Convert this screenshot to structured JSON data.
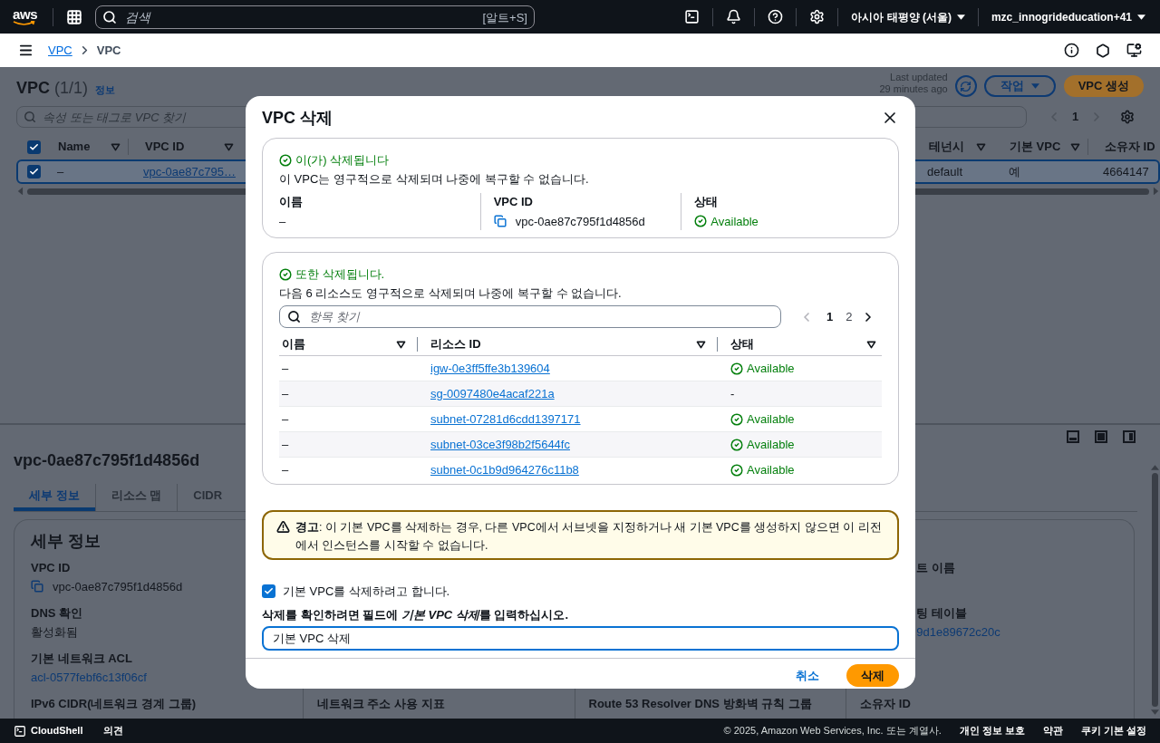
{
  "top_nav": {
    "logo": "aws",
    "search_placeholder": "검색",
    "shortcut": "[알트+S]",
    "region": "아시아 태평양 (서울)",
    "account": "mzc_innogrideducation+41"
  },
  "breadcrumbs": [
    {
      "label": "VPC",
      "link": true
    },
    {
      "label": "VPC",
      "link": false
    }
  ],
  "header": {
    "title": "VPC",
    "count": "(1/1)",
    "info": "정보",
    "last_updated": "Last updated",
    "updated_ago": "29 minutes ago",
    "actions_button": "작업",
    "create_button": "VPC 생성"
  },
  "filter": {
    "placeholder": "속성 또는 태그로 VPC 찾기",
    "page": "1"
  },
  "table": {
    "all_selected": true,
    "columns": [
      "Name",
      "VPC ID",
      "테넌시",
      "기본 VPC",
      "소유자 ID"
    ],
    "rows": [
      {
        "selected": true,
        "cells": [
          {
            "text": "–",
            "link": false
          },
          {
            "text": "vpc-0ae87c795…",
            "link": true
          },
          {
            "text": "default",
            "link": false
          },
          {
            "text": "예",
            "link": false
          },
          {
            "text": "4664147",
            "link": false
          }
        ]
      }
    ]
  },
  "split_panel": {
    "title": "vpc-0ae87c795f1d4856d",
    "tabs": [
      {
        "label": "세부 정보",
        "selected": true
      },
      {
        "label": "리소스 맵",
        "selected": false
      },
      {
        "label": "CIDR",
        "selected": false
      }
    ],
    "card_title": "세부 정보",
    "columns": [
      [
        {
          "label": "VPC ID",
          "value": "vpc-0ae87c795f1d4856d",
          "kind": "copy"
        },
        {
          "label": "DNS 확인",
          "value": "활성화됨",
          "kind": "text"
        },
        {
          "label": "기본 네트워크 ACL",
          "value": "acl-0577febf6c13f06cf",
          "kind": "link"
        },
        {
          "label": "IPv6 CIDR(네트워크 경계 그룹)"
        }
      ],
      [
        {
          "label": "네트워크 주소 사용 지표"
        }
      ],
      [
        {
          "label": "Route 53 Resolver DNS 방화벽 규칙 그룹"
        }
      ],
      [
        {
          "label": "트 이름",
          "kind": "cut"
        },
        {
          "label": "팅 테이블",
          "value": "9d1e89672c20c",
          "kind": "cut"
        },
        {
          "label": "소유자 ID"
        }
      ]
    ]
  },
  "modal": {
    "title": "VPC 삭제",
    "vpc_section": {
      "status": "이(가) 삭제됩니다",
      "description": "이 VPC는 영구적으로 삭제되며 나중에 복구할 수 없습니다.",
      "fields": [
        {
          "label": "이름",
          "value": "–",
          "kind": "text"
        },
        {
          "label": "VPC ID",
          "value": "vpc-0ae87c795f1d4856d",
          "kind": "copy"
        },
        {
          "label": "상태",
          "value": "Available",
          "kind": "status"
        }
      ]
    },
    "resources_section": {
      "status": "또한 삭제됩니다.",
      "description": "다음 6 리소스도 영구적으로 삭제되며 나중에 복구할 수 없습니다.",
      "search_placeholder": "항목 찾기",
      "pages": [
        {
          "label": "1",
          "selected": true
        },
        {
          "label": "2",
          "selected": false
        }
      ],
      "columns": [
        "이름",
        "리소스 ID",
        "상태"
      ],
      "rows": [
        {
          "name": "–",
          "resource_id": "igw-0e3ff5ffe3b139604",
          "status": "Available",
          "kind": "available"
        },
        {
          "name": "–",
          "resource_id": "sg-0097480e4acaf221a",
          "status": "-",
          "kind": "none"
        },
        {
          "name": "–",
          "resource_id": "subnet-07281d6cdd1397171",
          "status": "Available",
          "kind": "available"
        },
        {
          "name": "–",
          "resource_id": "subnet-03ce3f98b2f5644fc",
          "status": "Available",
          "kind": "available"
        },
        {
          "name": "–",
          "resource_id": "subnet-0c1b9d964276c11b8",
          "status": "Available",
          "kind": "available"
        }
      ]
    },
    "warning": "**경고**: 이 기본 VPC를 삭제하는 경우, 다른 VPC에서 서브넷을 지정하거나 새 기본 VPC를 생성하지 않으면 이 리전에서 인스턴스를 시작할 수 없습니다.",
    "confirm_checkbox": {
      "label": "기본 VPC를 삭제하려고 합니다.",
      "checked": true
    },
    "confirm_prompt": {
      "before": "삭제를 확인하려면 필드에 ",
      "emphasis": "기본 VPC 삭제",
      "after": "를 입력하십시오."
    },
    "confirm_input": {
      "value": "기본 VPC 삭제"
    },
    "cancel_button": "취소",
    "delete_button": "삭제"
  },
  "footer": {
    "cloudshell": "CloudShell",
    "feedback": "의견",
    "copyright": "© 2025, Amazon Web Services, Inc. 또는 계열사.",
    "links": [
      "개인 정보 보호",
      "약관",
      "쿠키 기본 설정"
    ]
  }
}
